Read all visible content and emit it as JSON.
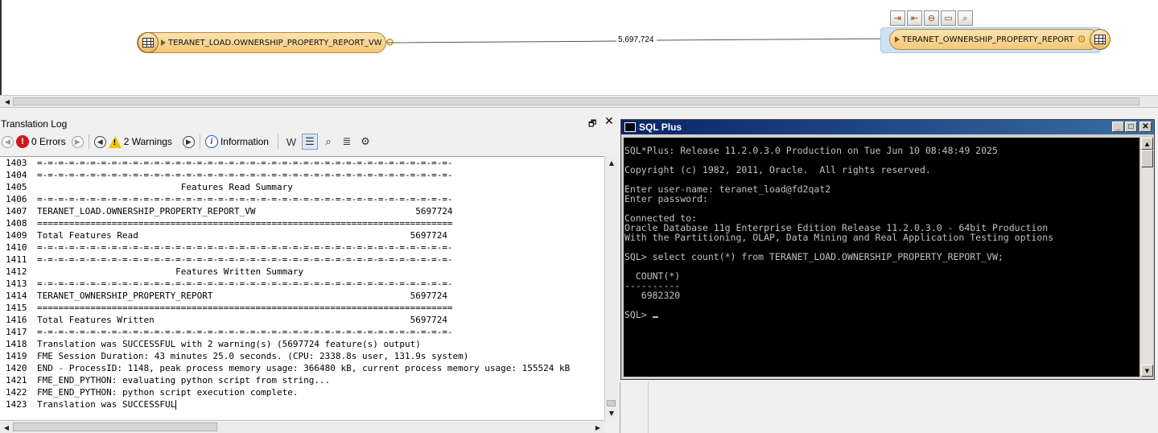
{
  "canvas": {
    "reader_node_label": "TERANET_LOAD.OWNERSHIP_PROPERTY_REPORT_VW",
    "connection_count": "5,697,724",
    "writer_node_label": "TERANET_OWNERSHIP_PROPERTY_REPORT",
    "writer_toolbar_icons": [
      "import-icon",
      "export-icon",
      "remove-icon",
      "folder-icon",
      "inspect-icon"
    ]
  },
  "log": {
    "title": "Translation Log",
    "errors_label": "0 Errors",
    "warnings_label": "2 Warnings",
    "information_label": "Information",
    "lines": [
      {
        "n": "1403",
        "t": "=-=-=-=-=-=-=-=-=-=-=-=-=-=-=-=-=-=-=-=-=-=-=-=-=-=-=-=-=-=-=-=-=-=-=-=-=-=-=-"
      },
      {
        "n": "1404",
        "t": "=-=-=-=-=-=-=-=-=-=-=-=-=-=-=-=-=-=-=-=-=-=-=-=-=-=-=-=-=-=-=-=-=-=-=-=-=-=-=-"
      },
      {
        "n": "1405",
        "t": "                           Features Read Summary"
      },
      {
        "n": "1406",
        "t": "=-=-=-=-=-=-=-=-=-=-=-=-=-=-=-=-=-=-=-=-=-=-=-=-=-=-=-=-=-=-=-=-=-=-=-=-=-=-=-"
      },
      {
        "n": "1407",
        "t": "TERANET_LOAD.OWNERSHIP_PROPERTY_REPORT_VW                              5697724"
      },
      {
        "n": "1408",
        "t": "=============================================================================="
      },
      {
        "n": "1409",
        "t": "Total Features Read                                                   5697724"
      },
      {
        "n": "1410",
        "t": "=-=-=-=-=-=-=-=-=-=-=-=-=-=-=-=-=-=-=-=-=-=-=-=-=-=-=-=-=-=-=-=-=-=-=-=-=-=-=-"
      },
      {
        "n": "1411",
        "t": "=-=-=-=-=-=-=-=-=-=-=-=-=-=-=-=-=-=-=-=-=-=-=-=-=-=-=-=-=-=-=-=-=-=-=-=-=-=-=-"
      },
      {
        "n": "1412",
        "t": "                          Features Written Summary"
      },
      {
        "n": "1413",
        "t": "=-=-=-=-=-=-=-=-=-=-=-=-=-=-=-=-=-=-=-=-=-=-=-=-=-=-=-=-=-=-=-=-=-=-=-=-=-=-=-"
      },
      {
        "n": "1414",
        "t": "TERANET_OWNERSHIP_PROPERTY_REPORT                                     5697724"
      },
      {
        "n": "1415",
        "t": "=============================================================================="
      },
      {
        "n": "1416",
        "t": "Total Features Written                                                5697724"
      },
      {
        "n": "1417",
        "t": "=-=-=-=-=-=-=-=-=-=-=-=-=-=-=-=-=-=-=-=-=-=-=-=-=-=-=-=-=-=-=-=-=-=-=-=-=-=-=-"
      },
      {
        "n": "1418",
        "t": "Translation was SUCCESSFUL with 2 warning(s) (5697724 feature(s) output)"
      },
      {
        "n": "1419",
        "t": "FME Session Duration: 43 minutes 25.0 seconds. (CPU: 2338.8s user, 131.9s system)"
      },
      {
        "n": "1420",
        "t": "END - ProcessID: 1148, peak process memory usage: 366480 kB, current process memory usage: 155524 kB"
      },
      {
        "n": "1421",
        "t": "FME_END_PYTHON: evaluating python script from string..."
      },
      {
        "n": "1422",
        "t": "FME_END_PYTHON: python script execution complete."
      },
      {
        "n": "1423",
        "t": "Translation was SUCCESSFUL"
      }
    ]
  },
  "sql": {
    "title": "SQL Plus",
    "lines": [
      "SQL*Plus: Release 11.2.0.3.0 Production on Tue Jun 10 08:48:49 2025",
      "",
      "Copyright (c) 1982, 2011, Oracle.  All rights reserved.",
      "",
      "Enter user-name: teranet_load@fd2qat2",
      "Enter password:",
      "",
      "Connected to:",
      "Oracle Database 11g Enterprise Edition Release 11.2.0.3.0 - 64bit Production",
      "With the Partitioning, OLAP, Data Mining and Real Application Testing options",
      "",
      "SQL> select count(*) from TERANET_LOAD.OWNERSHIP_PROPERTY_REPORT_VW;",
      "",
      "  COUNT(*)",
      "----------",
      "   6982320",
      "",
      "SQL> "
    ]
  }
}
